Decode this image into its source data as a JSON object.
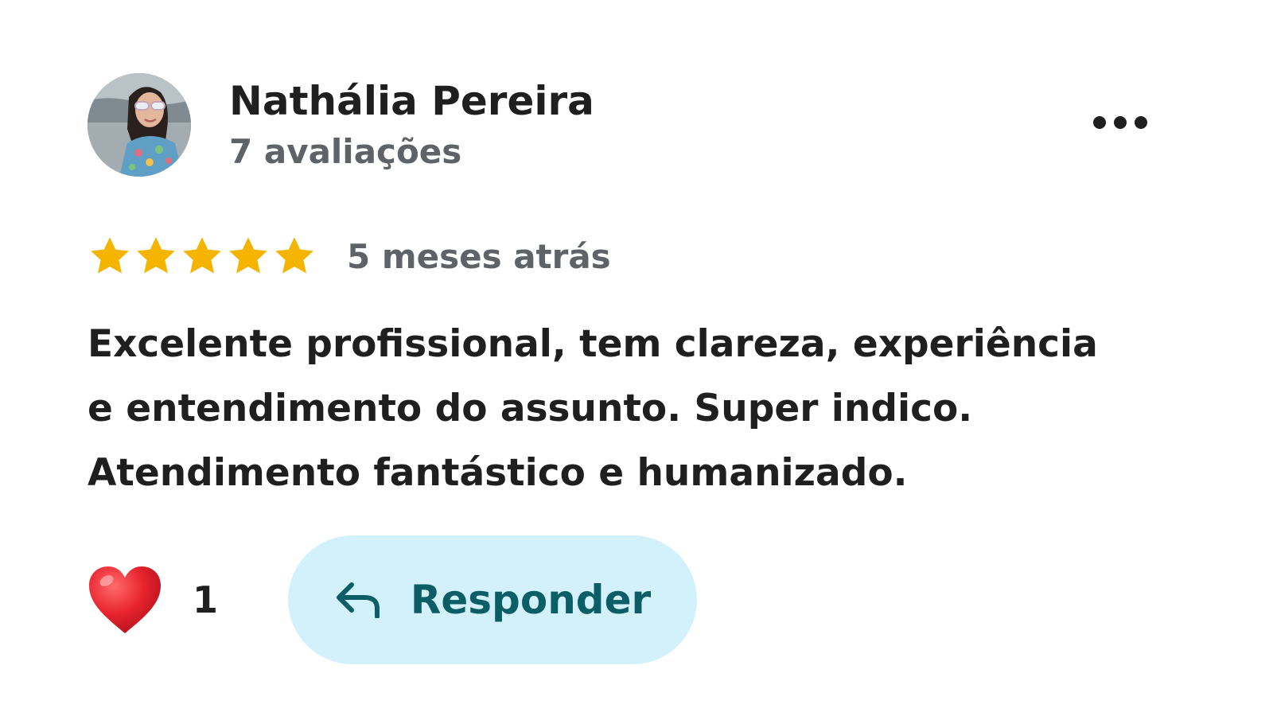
{
  "review": {
    "author": {
      "name": "Nathália Pereira",
      "reviews_count": "7 avaliações",
      "avatar": "profile-photo"
    },
    "more_options": {
      "icon": "more-horiz-icon"
    },
    "rating": {
      "stars": 5,
      "max": 5,
      "color": "#f4b400"
    },
    "time_ago": "5 meses atrás",
    "text_lines": [
      "Excelente profissional, tem clareza, experiência",
      "e entendimento do assunto. Super indico.",
      "Atendimento fantástico e humanizado."
    ],
    "reactions": {
      "icon": "heart-icon",
      "count": "1"
    },
    "reply": {
      "label": "Responder",
      "icon": "reply-arrow-icon",
      "bg_color": "#d3f1fb",
      "text_color": "#0b5e65"
    }
  }
}
